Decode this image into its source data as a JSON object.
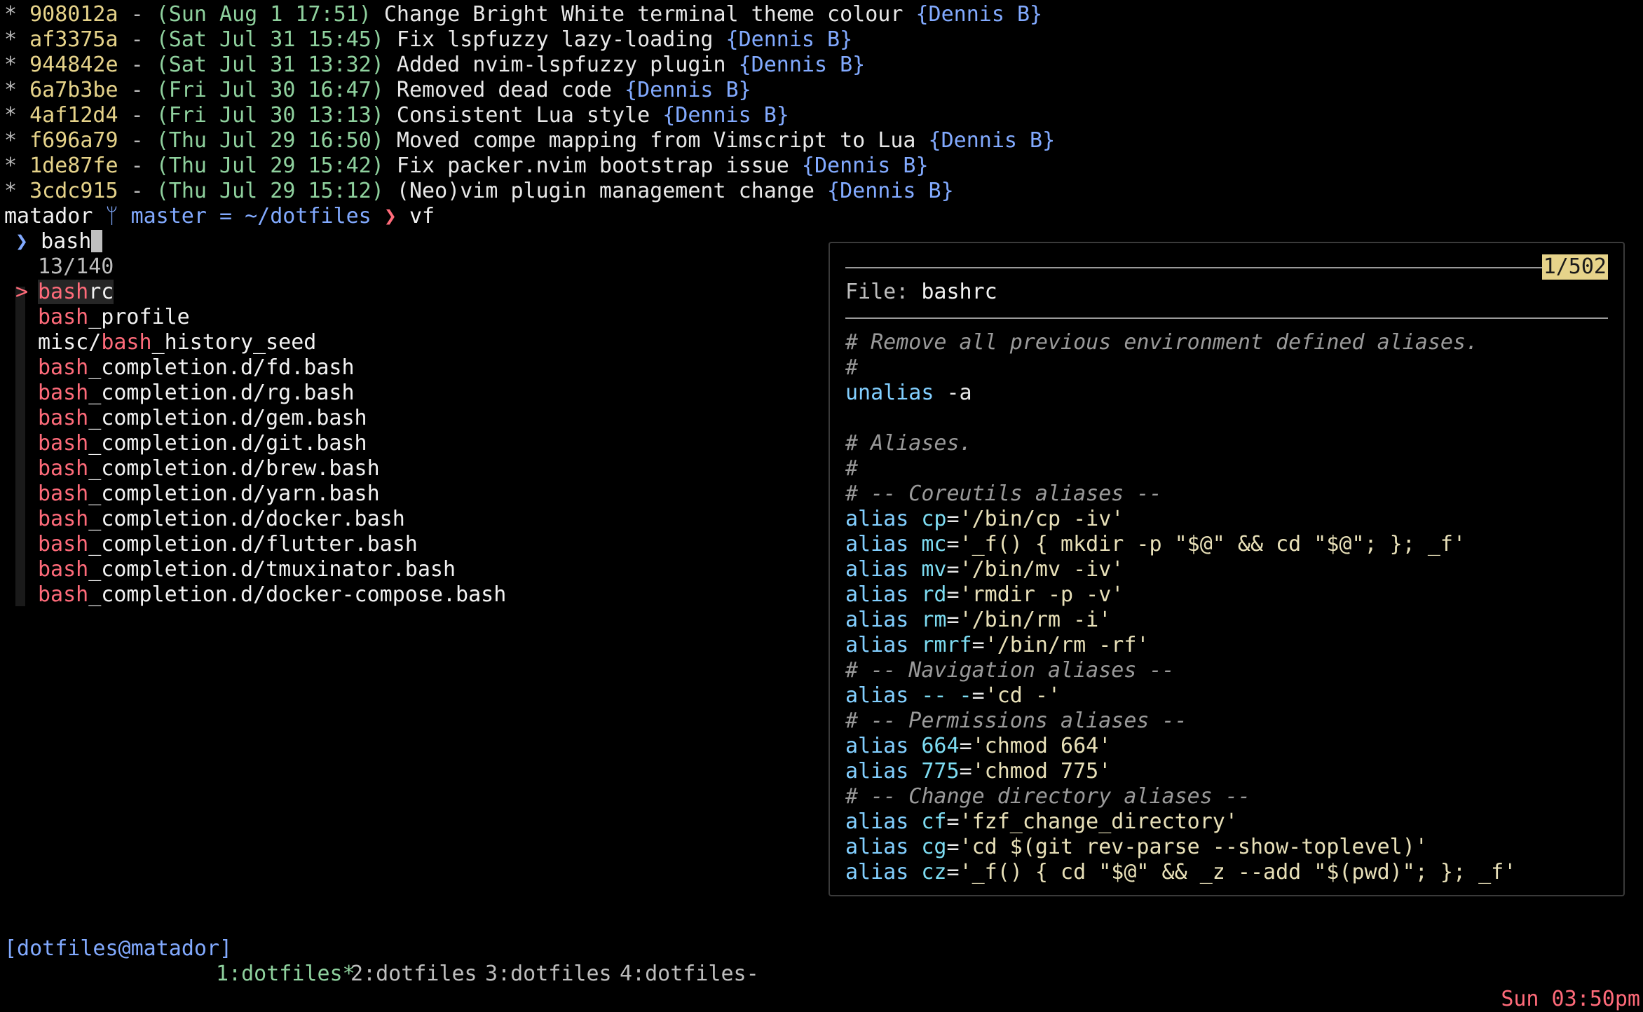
{
  "git_log": [
    {
      "hash": "908012a",
      "date": "(Sun Aug 1 17:51)",
      "message": "Change Bright White terminal theme colour",
      "author": "{Dennis B}"
    },
    {
      "hash": "af3375a",
      "date": "(Sat Jul 31 15:45)",
      "message": "Fix lspfuzzy lazy-loading",
      "author": "{Dennis B}"
    },
    {
      "hash": "944842e",
      "date": "(Sat Jul 31 13:32)",
      "message": "Added nvim-lspfuzzy plugin",
      "author": "{Dennis B}"
    },
    {
      "hash": "6a7b3be",
      "date": "(Fri Jul 30 16:47)",
      "message": "Removed dead code",
      "author": "{Dennis B}"
    },
    {
      "hash": "4af12d4",
      "date": "(Fri Jul 30 13:13)",
      "message": "Consistent Lua style",
      "author": "{Dennis B}"
    },
    {
      "hash": "f696a79",
      "date": "(Thu Jul 29 16:50)",
      "message": "Moved compe mapping from Vimscript to Lua",
      "author": "{Dennis B}"
    },
    {
      "hash": "1de87fe",
      "date": "(Thu Jul 29 15:42)",
      "message": "Fix packer.nvim bootstrap issue",
      "author": "{Dennis B}"
    },
    {
      "hash": "3cdc915",
      "date": "(Thu Jul 29 15:12)",
      "message": "(Neo)vim plugin management change",
      "author": "{Dennis B}"
    }
  ],
  "prompt": {
    "host": "matador",
    "branch_icon": "ᛘ",
    "branch": "master",
    "status": "=",
    "path": "~/dotfiles",
    "arrow": "❯",
    "command": "vf"
  },
  "fzf": {
    "prompt_symbol": "❯",
    "query": "bash",
    "count": "13/140",
    "pointer": ">",
    "results": [
      {
        "prefix": "",
        "match": "bash",
        "suffix": "rc"
      },
      {
        "prefix": "",
        "match": "bash",
        "suffix": "_profile"
      },
      {
        "prefix": "misc/",
        "match": "bash",
        "suffix": "_history_seed"
      },
      {
        "prefix": "",
        "match": "bash",
        "suffix": "_completion.d/fd.bash"
      },
      {
        "prefix": "",
        "match": "bash",
        "suffix": "_completion.d/rg.bash"
      },
      {
        "prefix": "",
        "match": "bash",
        "suffix": "_completion.d/gem.bash"
      },
      {
        "prefix": "",
        "match": "bash",
        "suffix": "_completion.d/git.bash"
      },
      {
        "prefix": "",
        "match": "bash",
        "suffix": "_completion.d/brew.bash"
      },
      {
        "prefix": "",
        "match": "bash",
        "suffix": "_completion.d/yarn.bash"
      },
      {
        "prefix": "",
        "match": "bash",
        "suffix": "_completion.d/docker.bash"
      },
      {
        "prefix": "",
        "match": "bash",
        "suffix": "_completion.d/flutter.bash"
      },
      {
        "prefix": "",
        "match": "bash",
        "suffix": "_completion.d/tmuxinator.bash"
      },
      {
        "prefix": "",
        "match": "bash",
        "suffix": "_completion.d/docker-compose.bash"
      }
    ]
  },
  "preview": {
    "position": "1/502",
    "file_label": "File:",
    "file_name": "bashrc",
    "lines": [
      {
        "type": "comment",
        "text": "# Remove all previous environment defined aliases."
      },
      {
        "type": "comment",
        "text": "#"
      },
      {
        "type": "cmd",
        "kw": "unalias",
        "rest": " -a"
      },
      {
        "type": "blank",
        "text": ""
      },
      {
        "type": "comment",
        "text": "# Aliases."
      },
      {
        "type": "comment",
        "text": "#"
      },
      {
        "type": "comment",
        "text": "# -- Coreutils aliases --"
      },
      {
        "type": "alias",
        "name": "cp",
        "value": "'/bin/cp -iv'"
      },
      {
        "type": "alias",
        "name": "mc",
        "value": "'_f() { mkdir -p \"$@\" && cd \"$@\"; }; _f'"
      },
      {
        "type": "alias",
        "name": "mv",
        "value": "'/bin/mv -iv'"
      },
      {
        "type": "alias",
        "name": "rd",
        "value": "'rmdir -p -v'"
      },
      {
        "type": "alias",
        "name": "rm",
        "value": "'/bin/rm -i'"
      },
      {
        "type": "alias",
        "name": "rmrf",
        "value": "'/bin/rm -rf'"
      },
      {
        "type": "comment",
        "text": "# -- Navigation aliases --"
      },
      {
        "type": "alias",
        "name": "-- -",
        "value": "'cd -'"
      },
      {
        "type": "comment",
        "text": "# -- Permissions aliases --"
      },
      {
        "type": "alias",
        "name": "664",
        "value": "'chmod 664'"
      },
      {
        "type": "alias",
        "name": "775",
        "value": "'chmod 775'"
      },
      {
        "type": "comment",
        "text": "# -- Change directory aliases --"
      },
      {
        "type": "alias",
        "name": "cf",
        "value": "'fzf_change_directory'"
      },
      {
        "type": "alias",
        "name": "cg",
        "value": "'cd $(git rev-parse --show-toplevel)'"
      },
      {
        "type": "alias",
        "name": "cz",
        "value": "'_f() { cd \"$@\" && _z --add \"$(pwd)\"; }; _f'"
      }
    ]
  },
  "statusbar": {
    "session": "[dotfiles@matador]",
    "windows": [
      {
        "label": "1:dotfiles*",
        "active": true
      },
      {
        "label": "2:dotfiles",
        "active": false
      },
      {
        "label": "3:dotfiles",
        "active": false
      },
      {
        "label": "4:dotfiles-",
        "active": false
      }
    ],
    "clock": "Sun 03:50pm"
  },
  "colors": {
    "background": "#000000",
    "hash": "#e6d38a",
    "date": "#8fd19e",
    "author": "#82aaff",
    "match": "#ff6b7a",
    "keyword": "#82cfff",
    "comment": "#9a9a9a"
  }
}
